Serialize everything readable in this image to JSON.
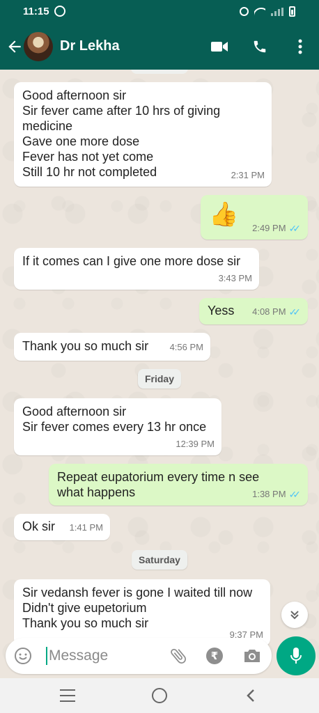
{
  "status_bar": {
    "time": "11:15"
  },
  "header": {
    "contact_name": "Dr Lekha"
  },
  "messages": [
    {
      "direction": "incoming",
      "text": "Good afternoon sir\nSir fever came after 10 hrs of giving medicine\nGave one more dose\nFever has not yet come\nStill 10 hr not completed",
      "time": "2:31 PM"
    },
    {
      "direction": "outgoing",
      "emoji": "👍",
      "time": "2:49 PM",
      "read": true
    },
    {
      "direction": "incoming",
      "text": "If it comes can I give one more dose sir",
      "time": "3:43 PM"
    },
    {
      "direction": "outgoing",
      "text": "Yess",
      "time": "4:08 PM",
      "read": true
    },
    {
      "direction": "incoming",
      "text": "Thank you so much sir",
      "time": "4:56 PM"
    },
    {
      "direction": "incoming",
      "text": "Good afternoon sir\nSir fever comes every 13 hr once",
      "time": "12:39 PM"
    },
    {
      "direction": "outgoing",
      "text": "Repeat eupatorium every time n see what happens",
      "time": "1:38 PM",
      "read": true
    },
    {
      "direction": "incoming",
      "text": "Ok sir",
      "time": "1:41 PM"
    },
    {
      "direction": "incoming",
      "text": "Sir vedansh fever is gone I waited till now\nDidn't give eupetorium\nThank you so much sir",
      "time": "9:37 PM"
    }
  ],
  "date_separators": {
    "friday": "Friday",
    "saturday": "Saturday"
  },
  "composer": {
    "placeholder": "Message",
    "rupee_symbol": "₹"
  },
  "colors": {
    "header": "#075e54",
    "outgoing_bubble": "#dcf8c6",
    "accent": "#00a884",
    "read_ticks": "#4fc3f7"
  }
}
